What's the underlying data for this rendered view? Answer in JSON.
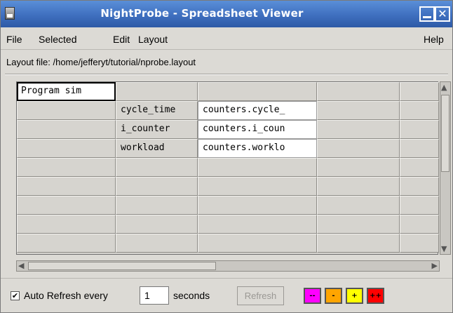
{
  "window": {
    "title": "NightProbe - Spreadsheet Viewer"
  },
  "menu": {
    "file": "File",
    "selected": "Selected",
    "edit": "Edit",
    "layout": "Layout",
    "help": "Help"
  },
  "layout_file": "Layout file: /home/jefferyt/tutorial/nprobe.layout",
  "sheet": {
    "rows": [
      [
        "Program sim",
        "",
        "",
        "",
        ""
      ],
      [
        "",
        "cycle_time",
        "counters.cycle_",
        "",
        ""
      ],
      [
        "",
        "i_counter",
        "counters.i_coun",
        "",
        ""
      ],
      [
        "",
        "workload",
        "counters.worklo",
        "",
        ""
      ],
      [
        "",
        "",
        "",
        "",
        ""
      ],
      [
        "",
        "",
        "",
        "",
        ""
      ],
      [
        "",
        "",
        "",
        "",
        ""
      ],
      [
        "",
        "",
        "",
        "",
        ""
      ],
      [
        "",
        "",
        "",
        "",
        ""
      ]
    ]
  },
  "controls": {
    "auto_refresh_checked": true,
    "auto_refresh_label": "Auto Refresh every",
    "interval_value": "1",
    "seconds_label": "seconds",
    "refresh_button": "Refresh",
    "color_buttons": [
      {
        "label": "--",
        "color": "#ff00ff"
      },
      {
        "label": "-",
        "color": "#ffa500"
      },
      {
        "label": "+",
        "color": "#ffff00"
      },
      {
        "label": "++",
        "color": "#ff0000"
      }
    ]
  },
  "icons": {
    "app": "app-window-icon",
    "minimize": "minimize-icon",
    "close": "close-icon",
    "check": "checkmark-icon",
    "up": "arrow-up-icon",
    "down": "arrow-down-icon",
    "left": "arrow-left-icon",
    "right": "arrow-right-icon"
  }
}
